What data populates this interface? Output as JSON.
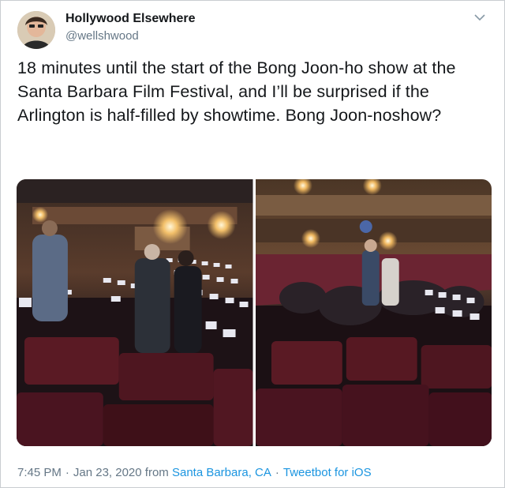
{
  "author": {
    "name": "Hollywood Elsewhere",
    "handle": "@wellshwood",
    "avatar_icon": "profile-photo-icon"
  },
  "tweet": {
    "text": "18 minutes until the start of the Bong Joon-ho show at the Santa Barbara Film Festival, and I’ll be surprised if the Arlington is half-filled by showtime.  Bong Joon-noshow?"
  },
  "media": {
    "photos": [
      {
        "semantic": "theater-photo-left"
      },
      {
        "semantic": "theater-photo-right"
      }
    ]
  },
  "footer": {
    "time": "7:45 PM",
    "date": "Jan 23, 2020",
    "from_label": "from",
    "location": "Santa Barbara, CA",
    "client": "Tweetbot for iOS",
    "separator": "·"
  },
  "colors": {
    "link": "#1b95e0",
    "secondary_text": "#657786",
    "primary_text": "#14171a"
  }
}
